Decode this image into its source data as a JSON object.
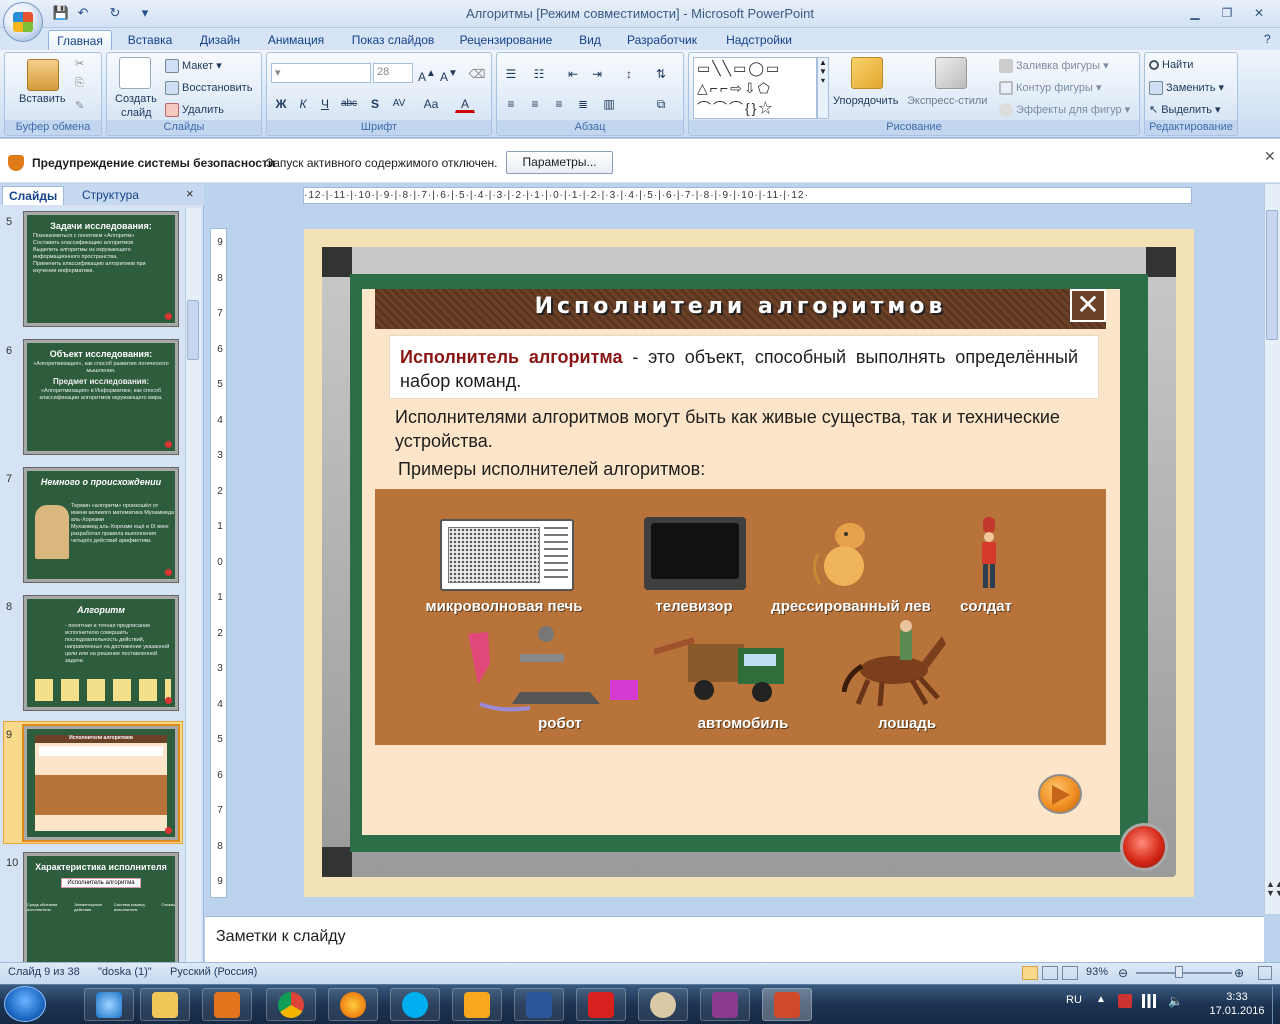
{
  "window": {
    "title": "Алгоритмы [Режим совместимости] - Microsoft PowerPoint"
  },
  "tabs": [
    "Главная",
    "Вставка",
    "Дизайн",
    "Анимация",
    "Показ слайдов",
    "Рецензирование",
    "Вид",
    "Разработчик",
    "Надстройки"
  ],
  "ribbon": {
    "clipboard": {
      "label": "Буфер обмена",
      "paste": "Вставить"
    },
    "slides": {
      "label": "Слайды",
      "create": "Создать",
      "create2": "слайд",
      "layout": "Макет",
      "reset": "Восстановить",
      "delete": "Удалить"
    },
    "font": {
      "label": "Шрифт",
      "size": "28"
    },
    "paragraph": {
      "label": "Абзац"
    },
    "drawing": {
      "label": "Рисование",
      "arrange": "Упорядочить",
      "quick_styles": "Экспресс-стили",
      "fill": "Заливка фигуры",
      "outline": "Контур фигуры",
      "effects": "Эффекты для фигур"
    },
    "editing": {
      "label": "Редактирование",
      "find": "Найти",
      "replace": "Заменить",
      "select": "Выделить"
    }
  },
  "security": {
    "title": "Предупреждение системы безопасности",
    "message": "Запуск активного содержимого отключен.",
    "button": "Параметры..."
  },
  "left_pane": {
    "tab_slides": "Слайды",
    "tab_outline": "Структура",
    "thumbs": [
      {
        "num": "5",
        "title": "Задачи исследования:",
        "lines": [
          "Познакомиться с понятием «Алгоритм»",
          "Составить классификацию алгоритмов",
          "Выделить алгоритмы из окружающего информационного пространства.",
          "Применить классификацию алгоритмов при изучении информатики."
        ]
      },
      {
        "num": "6",
        "title": "Объект исследования:",
        "lines": [
          "«Алгоритмизация», как способ развития логического мышления.",
          "Предмет исследования:",
          "«Алгоритмизация» в Информатике, как способ классификации алгоритмов окружающего мира."
        ]
      },
      {
        "num": "7",
        "title": "Немного о происхождении",
        "lines": [
          "Термин «алгоритм» произошёл от имени великого математика Мухаммеда аль-Хорезми",
          "Мухаммед аль-Хорезми ещё в IX веке разработал правила выполнения четырёх действий арифметики."
        ]
      },
      {
        "num": "8",
        "title": "Алгоритм",
        "lines": [
          "- понятная и точная предписание исполнителю совершить последовательность действий, направленных на достижение указанной цели или на решение поставленной задачи."
        ]
      },
      {
        "num": "9",
        "title": "Исполнители алгоритмов",
        "lines": []
      },
      {
        "num": "10",
        "title": "Характеристика исполнителя",
        "lines": [
          "Исполнитель алгоритма",
          "Среда обитания исполнителя",
          "Элементарные действия",
          "Система команд исполнителя",
          "Отказы"
        ]
      }
    ]
  },
  "ruler": {
    "h": "·12·|·11·|·10·|·9·|·8·|·7·|·6·|·5·|·4·|·3·|·2·|·1·|·0·|·1·|·2·|·3·|·4·|·5·|·6·|·7·|·8·|·9·|·10·|·11·|·12·",
    "v": [
      "9",
      "8",
      "7",
      "6",
      "5",
      "4",
      "3",
      "2",
      "1",
      "0",
      "1",
      "2",
      "3",
      "4",
      "5",
      "6",
      "7",
      "8",
      "9"
    ]
  },
  "slide": {
    "title": "Исполнители алгоритмов",
    "close_glyph": "✕",
    "definition_term": "Исполнитель алгоритма",
    "definition_rest": " - это объект, способный выполнять определённый набор команд.",
    "para1": "Исполнителями алгоритмов могут быть как живые существа, так и технические устройства.",
    "para2": "Примеры исполнителей алгоритмов:",
    "labels": {
      "microwave": "микроволновая печь",
      "tv": "телевизор",
      "lion": "дрессированный лев",
      "soldier": "солдат",
      "robot": "робот",
      "car": "автомобиль",
      "horse": "лошадь"
    }
  },
  "notes": {
    "placeholder": "Заметки к слайду"
  },
  "status": {
    "slide": "Слайд 9 из 38",
    "theme": "\"doska (1)\"",
    "lang": "Русский (Россия)",
    "zoom": "93%"
  },
  "tray": {
    "lang": "RU",
    "time": "3:33",
    "date": "17.01.2016"
  }
}
